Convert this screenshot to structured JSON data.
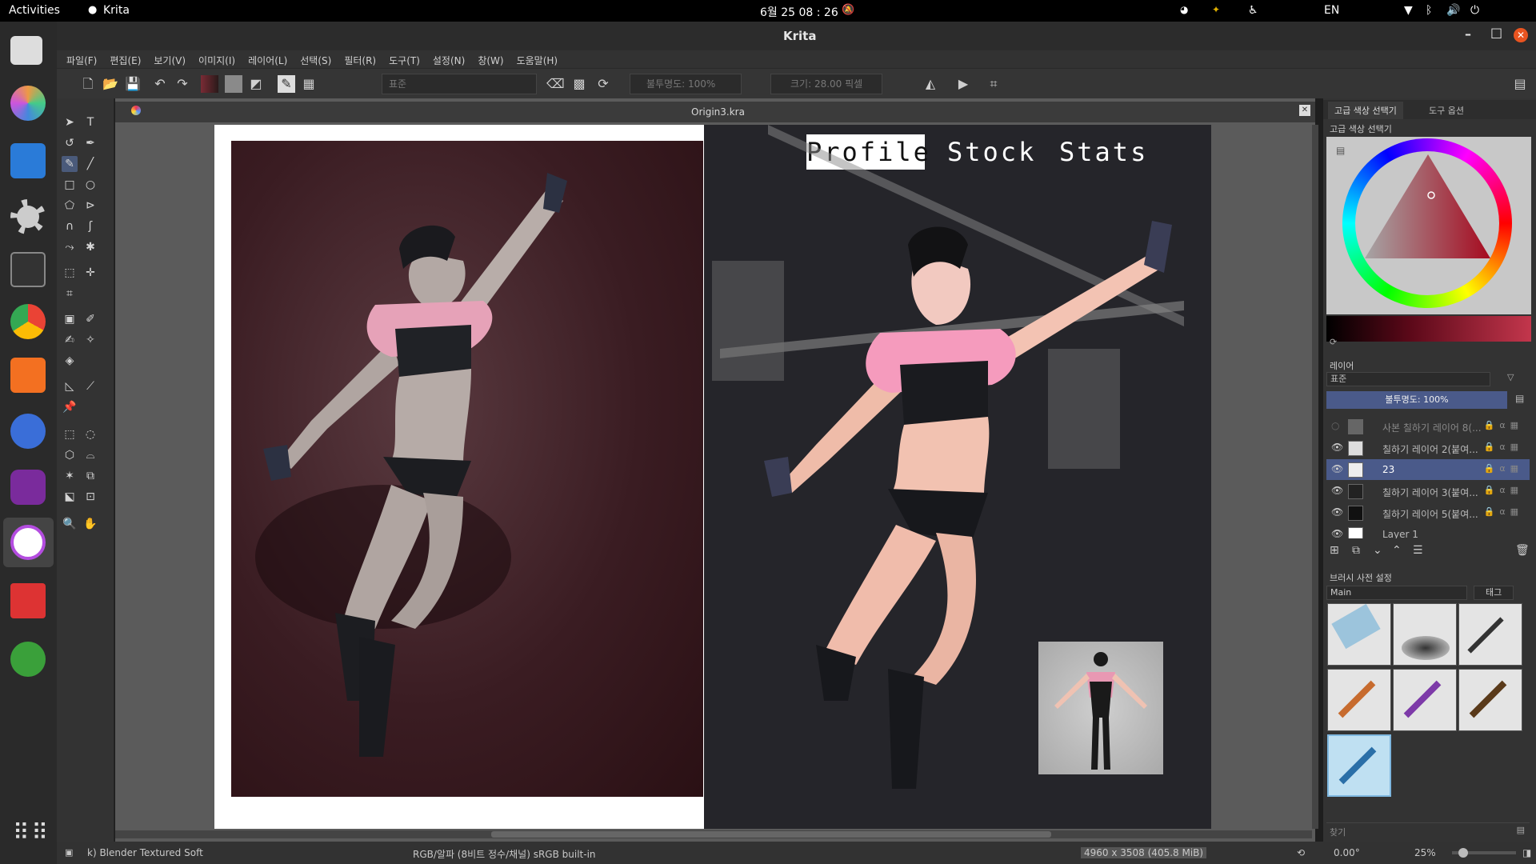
{
  "topbar": {
    "activities": "Activities",
    "app_name": "Krita",
    "clock": "6월 25  08 : 26",
    "lang": "EN"
  },
  "window": {
    "title": "Krita"
  },
  "menu": [
    "파일(F)",
    "편집(E)",
    "보기(V)",
    "이미지(I)",
    "레이어(L)",
    "선택(S)",
    "필터(R)",
    "도구(T)",
    "설정(N)",
    "창(W)",
    "도움말(H)"
  ],
  "toolbar": {
    "blend_mode": "표준",
    "opacity": "불투명도: 100%",
    "size": "크기: 28.00 픽셀"
  },
  "document": {
    "tab_title": "Origin3.kra",
    "image_tabs": [
      "Profile",
      "Stock",
      "Stats"
    ]
  },
  "docker": {
    "tabs": [
      "고급 색상 선택기",
      "도구 옵션"
    ],
    "color_panel_title": "고급 색상 선택기",
    "layers_title": "레이어",
    "layer_blend": "표준",
    "layer_opacity": "불투명도:  100%",
    "layers": [
      {
        "name": "사본 칠하기 레이어 8(...",
        "visible": false,
        "selected": false
      },
      {
        "name": "칠하기 레이어 2(붙여...",
        "visible": true,
        "selected": false
      },
      {
        "name": "23",
        "visible": true,
        "selected": true
      },
      {
        "name": "칠하기 레이어 3(붙여...",
        "visible": true,
        "selected": false
      },
      {
        "name": "칠하기 레이어 5(붙여...",
        "visible": true,
        "selected": false
      },
      {
        "name": "Layer 1",
        "visible": true,
        "selected": false
      }
    ],
    "brush_title": "브러시 사전 설정",
    "brush_group": "Main",
    "brush_tag": "태그",
    "search_placeholder": "찾기"
  },
  "status": {
    "brush": "k) Blender Textured Soft",
    "colorspace": "RGB/알파 (8비트 정수/채널)  sRGB built-in",
    "dimensions": "4960 x 3508 (405.8 MiB)",
    "rotation": "0.00°",
    "zoom": "25%"
  },
  "colors": {
    "accent": "#4a5a8a",
    "canvas_bg": "#5b5b5b",
    "panel_bg": "#333333"
  }
}
